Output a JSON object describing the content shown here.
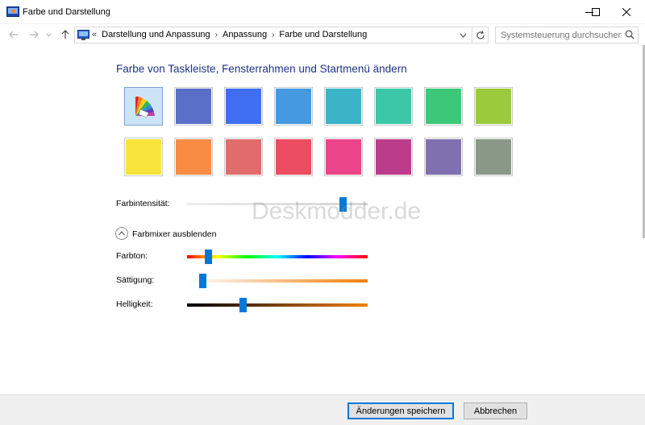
{
  "window": {
    "title": "Farbe und Darstellung"
  },
  "address": {
    "overflow": "«",
    "crumbs": [
      "Darstellung und Anpassung",
      "Anpassung",
      "Farbe und Darstellung"
    ]
  },
  "search": {
    "placeholder": "Systemsteuerung durchsuchen"
  },
  "heading": "Farbe von Taskleiste, Fensterrahmen und Startmenü ändern",
  "swatches": {
    "selected_index": 0,
    "row1": [
      "auto",
      "#5a6fc8",
      "#3f6ff0",
      "#4499e0",
      "#3cb4c8",
      "#3cc8a8",
      "#3cc878",
      "#9bcb3c"
    ],
    "row2": [
      "#f8e43c",
      "#f88c44",
      "#e06c6c",
      "#ec4c60",
      "#ec4488",
      "#bc3c8c",
      "#8070b0",
      "#8a9888"
    ]
  },
  "intensity": {
    "label": "Farbintensität:",
    "value": 0.88
  },
  "mixer": {
    "toggle_label": "Farbmixer ausblenden",
    "hue_label": "Farbton:",
    "hue_value": 0.1,
    "saturation_label": "Sättigung:",
    "saturation_value": 0.07,
    "brightness_label": "Helligkeit:",
    "brightness_value": 0.3
  },
  "watermark": "Deskmodder.de",
  "buttons": {
    "save": "Änderungen speichern",
    "cancel": "Abbrechen"
  },
  "colors": {
    "accent": "#0078d7",
    "heading": "#1e3287"
  }
}
